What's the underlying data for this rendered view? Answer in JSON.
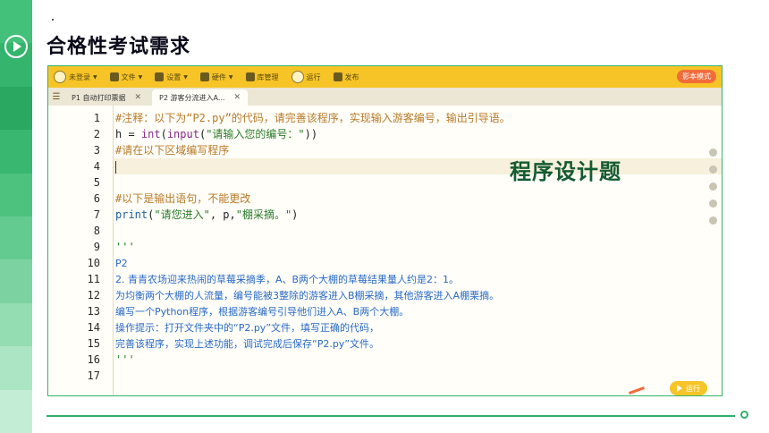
{
  "slide": {
    "title": "合格性考试需求",
    "badge": "程序设计题"
  },
  "toolbar": {
    "items": [
      {
        "label": "未登录",
        "icon": "avatar-icon"
      },
      {
        "label": "文件",
        "icon": "folder-icon"
      },
      {
        "label": "设置",
        "icon": "gear-icon"
      },
      {
        "label": "硬件",
        "icon": "hardware-icon"
      },
      {
        "label": "库管理",
        "icon": "library-icon"
      },
      {
        "label": "运行",
        "icon": "play-icon"
      },
      {
        "label": "发布",
        "icon": "publish-icon"
      }
    ],
    "mode_button": "影本模式"
  },
  "tabs": [
    {
      "label": "P1 自动打印票据",
      "active": false
    },
    {
      "label": "P2 游客分流进入A...",
      "active": true
    }
  ],
  "editor": {
    "current_line": 4,
    "lines": [
      {
        "n": "1",
        "parts": [
          {
            "c": "cm",
            "t": "#注释：以下为“P2.py”的代码，请完善该程序，实现输入游客编号，输出引导语。"
          }
        ]
      },
      {
        "n": "2",
        "parts": [
          {
            "c": "tx",
            "t": "h = "
          },
          {
            "c": "kw",
            "t": "int"
          },
          {
            "c": "tx",
            "t": "("
          },
          {
            "c": "kw",
            "t": "input"
          },
          {
            "c": "tx",
            "t": "("
          },
          {
            "c": "st",
            "t": "\"请输入您的编号：\""
          },
          {
            "c": "tx",
            "t": "))"
          }
        ]
      },
      {
        "n": "3",
        "parts": [
          {
            "c": "cm",
            "t": "#请在以下区域编写程序"
          }
        ]
      },
      {
        "n": "4",
        "parts": []
      },
      {
        "n": "5",
        "parts": []
      },
      {
        "n": "6",
        "parts": [
          {
            "c": "cm",
            "t": "#以下是输出语句，不能更改"
          }
        ]
      },
      {
        "n": "7",
        "parts": [
          {
            "c": "fn",
            "t": "print"
          },
          {
            "c": "tx",
            "t": "("
          },
          {
            "c": "st",
            "t": "\"请您进入\""
          },
          {
            "c": "tx",
            "t": ", p,"
          },
          {
            "c": "st",
            "t": "\"棚采摘。\""
          },
          {
            "c": "tx",
            "t": ")"
          }
        ]
      },
      {
        "n": "8",
        "parts": []
      },
      {
        "n": "9",
        "parts": [
          {
            "c": "st",
            "t": "'''"
          }
        ]
      },
      {
        "n": "10",
        "parts": [
          {
            "c": "txt",
            "t": "P2"
          }
        ]
      },
      {
        "n": "11",
        "parts": [
          {
            "c": "txt",
            "t": "2. 青青农场迎来热闹的草莓采摘季，A、B两个大棚的草莓结果量人约是2：1。"
          }
        ]
      },
      {
        "n": "12",
        "parts": [
          {
            "c": "txt",
            "t": "为均衡两个大棚的人流量，编号能被3整除的游客进入B棚采摘，其他游客进入A棚栗摘。"
          }
        ]
      },
      {
        "n": "13",
        "parts": [
          {
            "c": "txt",
            "t": "编写一个Python程序，根据游客编号引导他们进入A、B两个大棚。"
          }
        ]
      },
      {
        "n": "14",
        "parts": [
          {
            "c": "txt",
            "t": "操作提示：打开文件夹中的“P2.py”文件，填写正确的代码，"
          }
        ]
      },
      {
        "n": "15",
        "parts": [
          {
            "c": "txt",
            "t": "完善该程序，实现上述功能，调试完成后保存“P2.py”文件。"
          }
        ]
      },
      {
        "n": "16",
        "parts": [
          {
            "c": "st",
            "t": "'''"
          }
        ]
      },
      {
        "n": "17",
        "parts": []
      }
    ],
    "run_button": "运行"
  },
  "colors": {
    "toolbar": "#f6c427",
    "accent_green": "#2fb06a",
    "mode_button": "#f26b3a"
  }
}
